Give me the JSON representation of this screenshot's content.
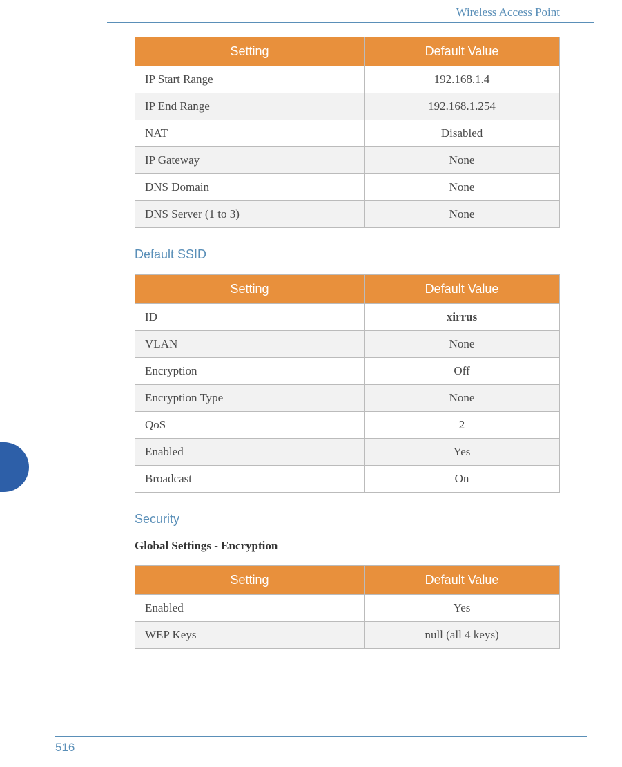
{
  "header": {
    "title": "Wireless Access Point"
  },
  "table1": {
    "col1": "Setting",
    "col2": "Default Value",
    "rows": [
      {
        "setting": "IP Start Range",
        "value": "192.168.1.4"
      },
      {
        "setting": "IP End Range",
        "value": "192.168.1.254"
      },
      {
        "setting": "NAT",
        "value": "Disabled"
      },
      {
        "setting": "IP Gateway",
        "value": "None"
      },
      {
        "setting": "DNS Domain",
        "value": "None"
      },
      {
        "setting": "DNS Server (1 to 3)",
        "value": "None"
      }
    ]
  },
  "section1": {
    "heading": "Default SSID"
  },
  "table2": {
    "col1": "Setting",
    "col2": "Default Value",
    "rows": [
      {
        "setting": "ID",
        "value": "xirrus",
        "bold": true
      },
      {
        "setting": "VLAN",
        "value": "None"
      },
      {
        "setting": "Encryption",
        "value": "Off"
      },
      {
        "setting": "Encryption Type",
        "value": "None"
      },
      {
        "setting": "QoS",
        "value": "2"
      },
      {
        "setting": "Enabled",
        "value": "Yes"
      },
      {
        "setting": "Broadcast",
        "value": "On"
      }
    ]
  },
  "section2": {
    "heading": "Security"
  },
  "subsection2": {
    "heading": "Global Settings - Encryption"
  },
  "table3": {
    "col1": "Setting",
    "col2": "Default Value",
    "rows": [
      {
        "setting": "Enabled",
        "value": "Yes"
      },
      {
        "setting": "WEP Keys",
        "value": "null (all 4 keys)"
      }
    ]
  },
  "footer": {
    "page_number": "516"
  }
}
